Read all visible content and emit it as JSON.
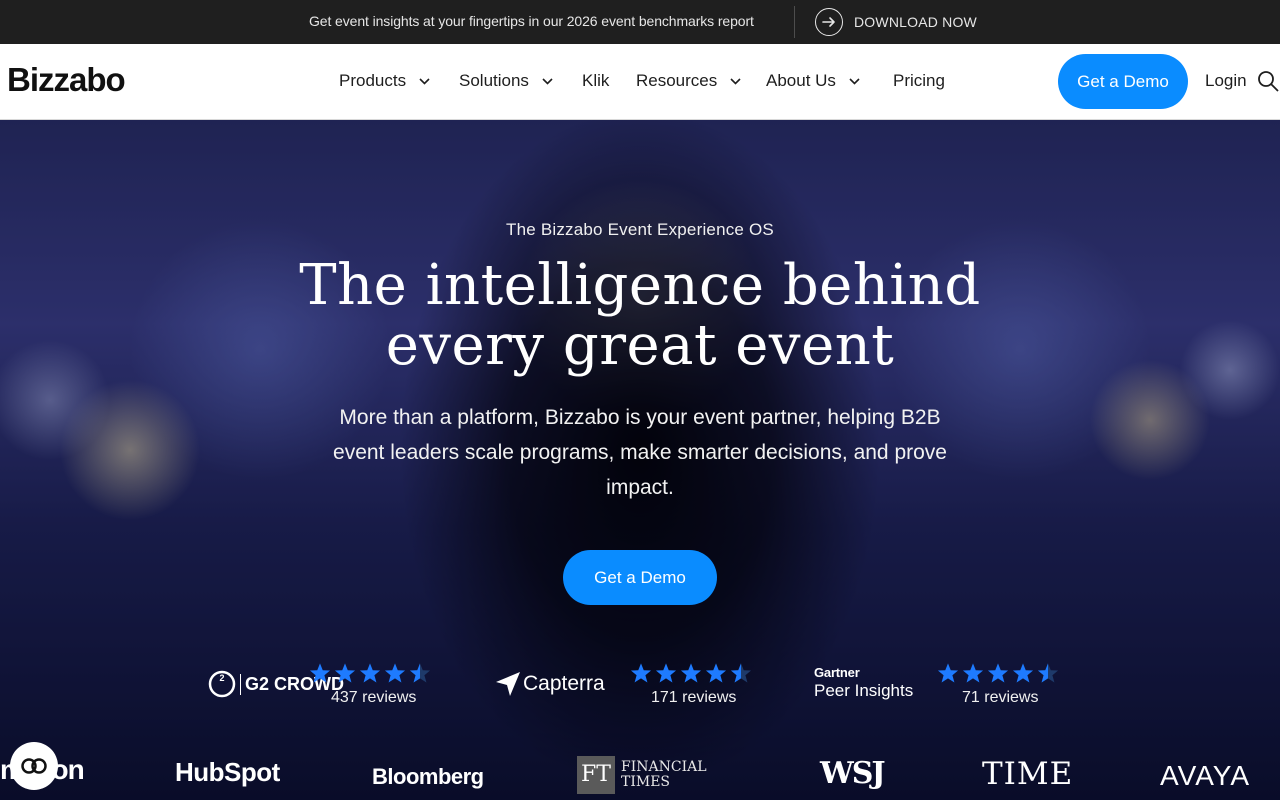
{
  "announcement": {
    "text": "Get event insights at your fingertips in our 2026 event benchmarks report",
    "cta_label": "DOWNLOAD NOW",
    "cta_icon": "arrow-right-circle-icon"
  },
  "header": {
    "logo": "Bizzabo",
    "nav": [
      {
        "label": "Products",
        "has_dropdown": true
      },
      {
        "label": "Solutions",
        "has_dropdown": true
      },
      {
        "label": "Klik",
        "has_dropdown": false
      },
      {
        "label": "Resources",
        "has_dropdown": true
      },
      {
        "label": "About Us",
        "has_dropdown": true
      },
      {
        "label": "Pricing",
        "has_dropdown": false
      }
    ],
    "demo_label": "Get a Demo",
    "login_label": "Login",
    "search_icon": "search-icon"
  },
  "hero": {
    "eyebrow": "The Bizzabo Event Experience OS",
    "headline_line1": "The intelligence behind",
    "headline_line2": "every great event",
    "subtext": "More than a platform, Bizzabo is your event partner, helping B2B event leaders scale programs, make smarter decisions, and prove impact.",
    "demo_label": "Get a Demo"
  },
  "reviews": [
    {
      "source": "G2 CROWD",
      "rating": 4.5,
      "count_label": "437 reviews"
    },
    {
      "source": "Capterra",
      "rating": 4.5,
      "count_label": "171 reviews"
    },
    {
      "source_line1": "Gartner",
      "source_line2": "Peer Insights",
      "rating": 4.5,
      "count_label": "71 reviews"
    }
  ],
  "brands": [
    "amazon",
    "HubSpot",
    "Bloomberg",
    "FINANCIAL TIMES",
    "WSJ",
    "TIME",
    "AVAYA"
  ],
  "brand_ft_mark": "FT",
  "brand_ft_line1": "FINANCIAL",
  "brand_ft_line2": "TIMES",
  "brand_amazon_visible": "mazon",
  "colors": {
    "accent": "#0a8cff",
    "star": "#1e7bff",
    "announce_bg": "#1f1f1f"
  },
  "chat_icon": "chat-widget-icon"
}
